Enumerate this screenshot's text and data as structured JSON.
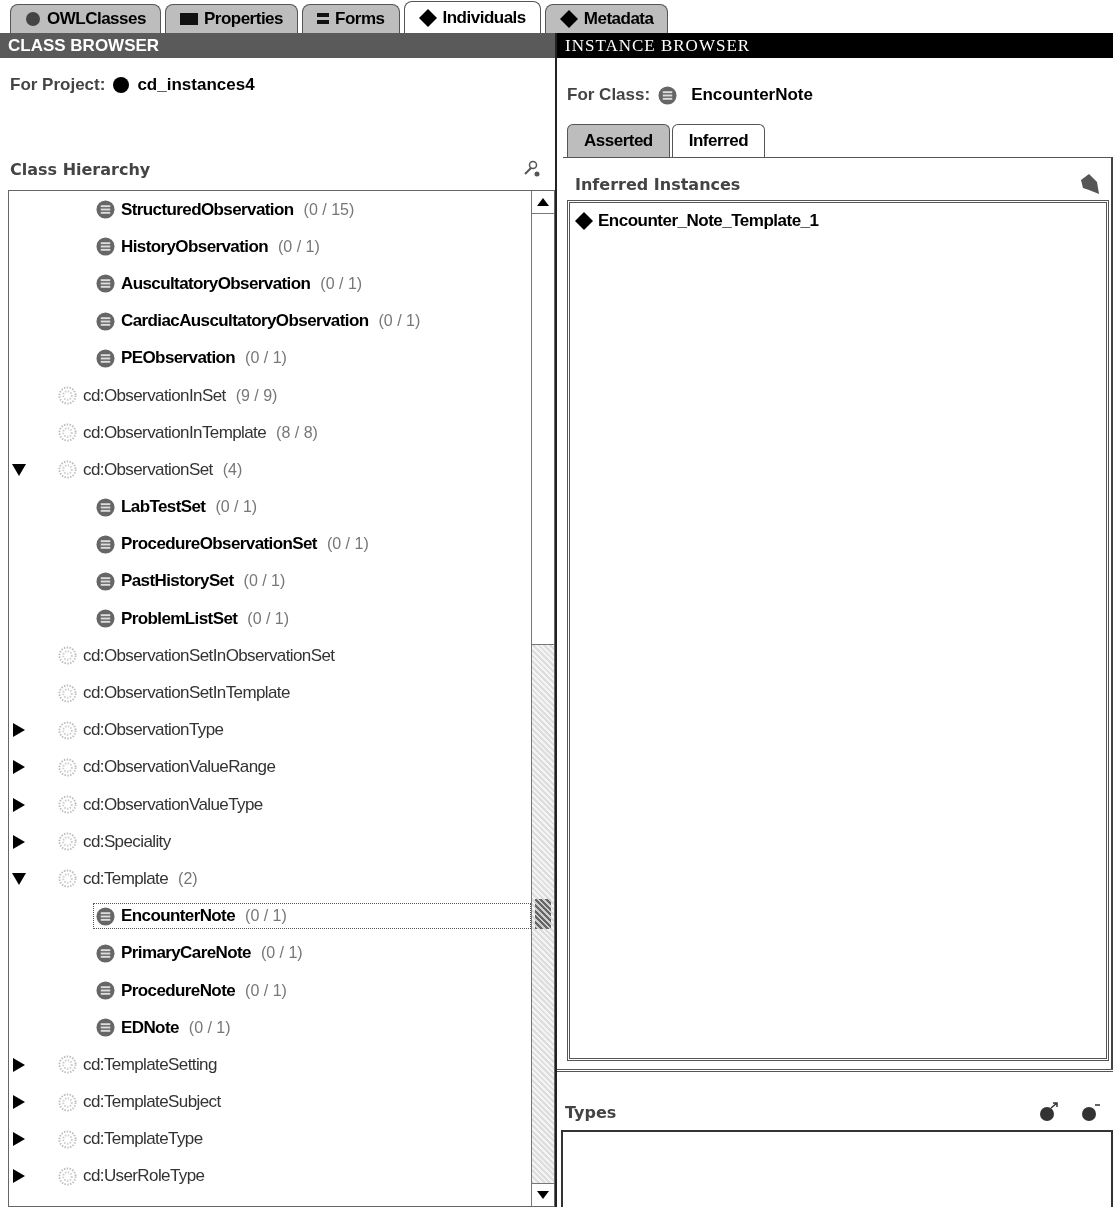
{
  "tabs": [
    {
      "label": "OWLClasses",
      "selected": false
    },
    {
      "label": "Properties",
      "selected": false
    },
    {
      "label": "Forms",
      "selected": false
    },
    {
      "label": "Individuals",
      "selected": true
    },
    {
      "label": "Metadata",
      "selected": false
    }
  ],
  "class_browser": {
    "title": "CLASS BROWSER",
    "project_label": "For Project:",
    "project_name": "cd_instances4",
    "hierarchy_title": "Class Hierarchy",
    "tree": {
      "scrolled_rows": [
        {
          "label": "StructuredObservation",
          "count": "(0 / 15)",
          "kind": "defined",
          "selected": false
        },
        {
          "label": "HistoryObservation",
          "count": "(0 / 1)",
          "kind": "defined",
          "selected": false
        },
        {
          "label": "AuscultatoryObservation",
          "count": "(0 / 1)",
          "kind": "defined",
          "selected": false
        },
        {
          "label": "CardiacAuscultatoryObservation",
          "count": "(0 / 1)",
          "kind": "defined",
          "selected": false
        },
        {
          "label": "PEObservation",
          "count": "(0 / 1)",
          "kind": "defined",
          "selected": false
        }
      ],
      "items": [
        {
          "label": "cd:ObservationInSet",
          "count": "(9 / 9)",
          "kind": "primitive",
          "selected": false
        },
        {
          "label": "cd:ObservationInTemplate",
          "count": "(8 / 8)",
          "kind": "primitive",
          "selected": false
        },
        {
          "label": "cd:ObservationSet",
          "count": "(4)",
          "kind": "primitive",
          "selected": false,
          "expanded": true,
          "children": [
            {
              "label": "LabTestSet",
              "count": "(0 / 1)",
              "kind": "defined",
              "selected": false
            },
            {
              "label": "ProcedureObservationSet",
              "count": "(0 / 1)",
              "kind": "defined",
              "selected": false
            },
            {
              "label": "PastHistorySet",
              "count": "(0 / 1)",
              "kind": "defined",
              "selected": false
            },
            {
              "label": "ProblemListSet",
              "count": "(0 / 1)",
              "kind": "defined",
              "selected": false
            }
          ]
        },
        {
          "label": "cd:ObservationSetInObservationSet",
          "kind": "primitive",
          "selected": false
        },
        {
          "label": "cd:ObservationSetInTemplate",
          "kind": "primitive",
          "selected": false
        },
        {
          "label": "cd:ObservationType",
          "kind": "primitive",
          "selected": false,
          "expanded": false
        },
        {
          "label": "cd:ObservationValueRange",
          "kind": "primitive",
          "selected": false,
          "expanded": false
        },
        {
          "label": "cd:ObservationValueType",
          "kind": "primitive",
          "selected": false,
          "expanded": false
        },
        {
          "label": "cd:Speciality",
          "kind": "primitive",
          "selected": false,
          "expanded": false
        },
        {
          "label": "cd:Template",
          "count": "(2)",
          "kind": "primitive",
          "selected": false,
          "expanded": true,
          "children": [
            {
              "label": "EncounterNote",
              "count": "(0 / 1)",
              "kind": "defined",
              "selected": true
            },
            {
              "label": "PrimaryCareNote",
              "count": "(0 / 1)",
              "kind": "defined",
              "selected": false
            },
            {
              "label": "ProcedureNote",
              "count": "(0 / 1)",
              "kind": "defined",
              "selected": false
            },
            {
              "label": "EDNote",
              "count": "(0 / 1)",
              "kind": "defined",
              "selected": false
            }
          ]
        },
        {
          "label": "cd:TemplateSetting",
          "kind": "primitive",
          "selected": false,
          "expanded": false
        },
        {
          "label": "cd:TemplateSubject",
          "kind": "primitive",
          "selected": false,
          "expanded": false
        },
        {
          "label": "cd:TemplateType",
          "kind": "primitive",
          "selected": false,
          "expanded": false
        },
        {
          "label": "cd:UserRoleType",
          "kind": "primitive",
          "selected": false,
          "expanded": false
        }
      ]
    }
  },
  "instance_browser": {
    "title": "INSTANCE BROWSER",
    "class_label": "For Class:",
    "class_name": "EncounterNote",
    "tabs": [
      {
        "label": "Asserted",
        "selected": false
      },
      {
        "label": "Inferred",
        "selected": true
      }
    ],
    "instances_title": "Inferred Instances",
    "instances": [
      {
        "label": "Encounter_Note_Template_1",
        "selected": false
      }
    ],
    "types_title": "Types"
  }
}
